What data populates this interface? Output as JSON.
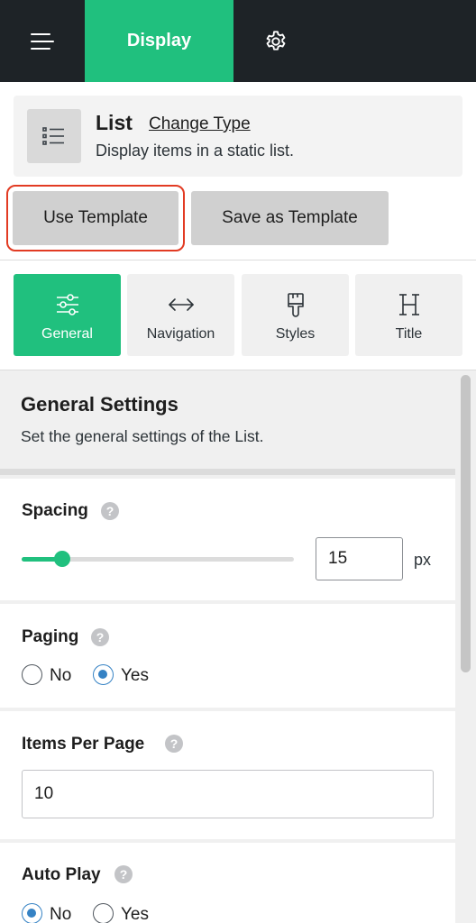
{
  "topbar": {
    "menu_icon": "hamburger-icon",
    "active_tab": "Display",
    "settings_icon": "gear-icon",
    "background": "#1e2327",
    "accent": "#20c07e"
  },
  "type_card": {
    "icon": "list-icon",
    "name": "List",
    "change_link": "Change Type",
    "description": "Display items in a static list."
  },
  "template_buttons": {
    "use_template": "Use Template",
    "save_as_template": "Save as Template",
    "highlight_color": "#e23b23"
  },
  "section_tabs": [
    {
      "label": "General",
      "icon": "sliders-icon",
      "active": true
    },
    {
      "label": "Navigation",
      "icon": "arrows-horizontal-icon",
      "active": false
    },
    {
      "label": "Styles",
      "icon": "paintbrush-icon",
      "active": false
    },
    {
      "label": "Title",
      "icon": "heading-icon",
      "active": false
    }
  ],
  "general_settings": {
    "title": "General Settings",
    "description": "Set the general settings of the List."
  },
  "fields": {
    "spacing": {
      "label": "Spacing",
      "value": "15",
      "unit": "px",
      "slider_fraction": 0.15
    },
    "paging": {
      "label": "Paging",
      "options": [
        "No",
        "Yes"
      ],
      "selected": "Yes"
    },
    "items_per_page": {
      "label": "Items Per Page",
      "value": "10"
    },
    "auto_play": {
      "label": "Auto Play",
      "options": [
        "No",
        "Yes"
      ],
      "selected": "No"
    }
  },
  "help_glyph": "?"
}
